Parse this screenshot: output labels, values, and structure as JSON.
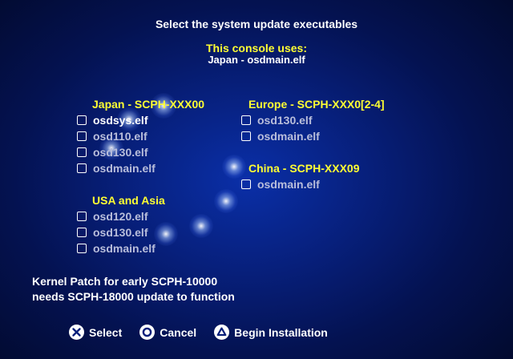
{
  "header": {
    "title": "Select the system update executables",
    "console_uses_label": "This console uses:",
    "console_uses_value": "Japan - osdmain.elf"
  },
  "groups": {
    "japan": {
      "title": "Japan - SCPH-XXX00",
      "items": [
        {
          "label": "osdsys.elf",
          "checked": false
        },
        {
          "label": "osd110.elf",
          "checked": false
        },
        {
          "label": "osd130.elf",
          "checked": false
        },
        {
          "label": "osdmain.elf",
          "checked": false
        }
      ]
    },
    "usa_asia": {
      "title": "USA and Asia",
      "items": [
        {
          "label": "osd120.elf",
          "checked": false
        },
        {
          "label": "osd130.elf",
          "checked": false
        },
        {
          "label": "osdmain.elf",
          "checked": false
        }
      ]
    },
    "europe": {
      "title": "Europe - SCPH-XXX0[2-4]",
      "items": [
        {
          "label": "osd130.elf",
          "checked": false
        },
        {
          "label": "osdmain.elf",
          "checked": false
        }
      ]
    },
    "china": {
      "title": "China - SCPH-XXX09",
      "items": [
        {
          "label": "osdmain.elf",
          "checked": false
        }
      ]
    }
  },
  "note": {
    "line1": "Kernel Patch for early SCPH-10000",
    "line2": "needs SCPH-18000 update to function"
  },
  "buttons": {
    "select": {
      "icon": "cross-icon",
      "label": "Select"
    },
    "cancel": {
      "icon": "circle-icon",
      "label": "Cancel"
    },
    "install": {
      "icon": "triangle-icon",
      "label": "Begin Installation"
    }
  },
  "colors": {
    "heading": "#ffff33",
    "text": "#ffffff",
    "dim_text": "#b9bedb",
    "background": "#071f7a"
  }
}
